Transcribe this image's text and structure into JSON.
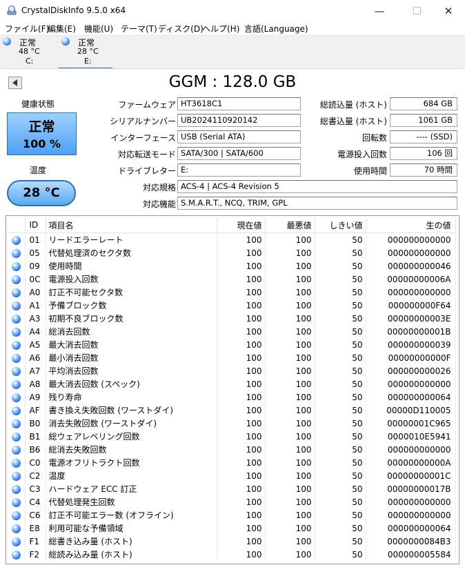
{
  "window": {
    "title": "CrystalDiskInfo 9.5.0 x64",
    "minimize_icon": "minimize-icon",
    "maximize_icon": "maximize-icon",
    "close_icon": "close-icon"
  },
  "menu": [
    "ファイル(F)",
    "編集(E)",
    "機能(U)",
    "テーマ(T)",
    "ディスク(D)",
    "ヘルプ(H)",
    "言語(Language)"
  ],
  "disks": [
    {
      "status": "正常",
      "temp": "48 °C",
      "drive": "C:"
    },
    {
      "status": "正常",
      "temp": "28 °C",
      "drive": "E:"
    }
  ],
  "model": "GGM : 128.0 GB",
  "health": {
    "label": "健康状態",
    "status": "正常",
    "percent": "100 %"
  },
  "temperature": {
    "label": "温度",
    "value": "28 °C"
  },
  "info": {
    "firmware_label": "ファームウェア",
    "firmware": "HT3618C1",
    "serial_label": "シリアルナンバー",
    "serial": "UB2024110920142",
    "interface_label": "インターフェース",
    "interface": "USB (Serial ATA)",
    "transfer_label": "対応転送モード",
    "transfer": "SATA/300 | SATA/600",
    "letter_label": "ドライブレター",
    "letter": "E:",
    "standard_label": "対応規格",
    "standard": "ACS-4 | ACS-4 Revision 5",
    "features_label": "対応機能",
    "features": "S.M.A.R.T., NCQ, TRIM, GPL",
    "host_reads_label": "総読込量 (ホスト)",
    "host_reads": "684 GB",
    "host_writes_label": "総書込量 (ホスト)",
    "host_writes": "1061 GB",
    "rotation_label": "回転数",
    "rotation": "---- (SSD)",
    "power_count_label": "電源投入回数",
    "power_count": "106 回",
    "power_hours_label": "使用時間",
    "power_hours": "70 時間"
  },
  "smart": {
    "headers": {
      "id": "ID",
      "name": "項目名",
      "current": "現在値",
      "worst": "最悪値",
      "threshold": "しきい値",
      "raw": "生の値"
    },
    "rows": [
      {
        "id": "01",
        "name": "リードエラーレート",
        "current": "100",
        "worst": "100",
        "threshold": "50",
        "raw": "000000000000"
      },
      {
        "id": "05",
        "name": "代替処理済のセクタ数",
        "current": "100",
        "worst": "100",
        "threshold": "50",
        "raw": "000000000000"
      },
      {
        "id": "09",
        "name": "使用時間",
        "current": "100",
        "worst": "100",
        "threshold": "50",
        "raw": "000000000046"
      },
      {
        "id": "0C",
        "name": "電源投入回数",
        "current": "100",
        "worst": "100",
        "threshold": "50",
        "raw": "00000000006A"
      },
      {
        "id": "A0",
        "name": "訂正不可能セクタ数",
        "current": "100",
        "worst": "100",
        "threshold": "50",
        "raw": "000000000000"
      },
      {
        "id": "A1",
        "name": "予備ブロック数",
        "current": "100",
        "worst": "100",
        "threshold": "50",
        "raw": "000000000F64"
      },
      {
        "id": "A3",
        "name": "初期不良ブロック数",
        "current": "100",
        "worst": "100",
        "threshold": "50",
        "raw": "00000000003E"
      },
      {
        "id": "A4",
        "name": "総消去回数",
        "current": "100",
        "worst": "100",
        "threshold": "50",
        "raw": "00000000001B"
      },
      {
        "id": "A5",
        "name": "最大消去回数",
        "current": "100",
        "worst": "100",
        "threshold": "50",
        "raw": "000000000039"
      },
      {
        "id": "A6",
        "name": "最小消去回数",
        "current": "100",
        "worst": "100",
        "threshold": "50",
        "raw": "00000000000F"
      },
      {
        "id": "A7",
        "name": "平均消去回数",
        "current": "100",
        "worst": "100",
        "threshold": "50",
        "raw": "000000000026"
      },
      {
        "id": "A8",
        "name": "最大消去回数 (スペック)",
        "current": "100",
        "worst": "100",
        "threshold": "50",
        "raw": "000000000000"
      },
      {
        "id": "A9",
        "name": "残り寿命",
        "current": "100",
        "worst": "100",
        "threshold": "50",
        "raw": "000000000064"
      },
      {
        "id": "AF",
        "name": "書き換え失敗回数 (ワーストダイ)",
        "current": "100",
        "worst": "100",
        "threshold": "50",
        "raw": "00000D110005"
      },
      {
        "id": "B0",
        "name": "消去失敗回数 (ワーストダイ)",
        "current": "100",
        "worst": "100",
        "threshold": "50",
        "raw": "00000001C965"
      },
      {
        "id": "B1",
        "name": "総ウェアレベリング回数",
        "current": "100",
        "worst": "100",
        "threshold": "50",
        "raw": "0000010E5941"
      },
      {
        "id": "B6",
        "name": "総消去失敗回数",
        "current": "100",
        "worst": "100",
        "threshold": "50",
        "raw": "000000000000"
      },
      {
        "id": "C0",
        "name": "電源オフリトラクト回数",
        "current": "100",
        "worst": "100",
        "threshold": "50",
        "raw": "00000000000A"
      },
      {
        "id": "C2",
        "name": "温度",
        "current": "100",
        "worst": "100",
        "threshold": "50",
        "raw": "00000000001C"
      },
      {
        "id": "C3",
        "name": "ハードウェア ECC 訂正",
        "current": "100",
        "worst": "100",
        "threshold": "50",
        "raw": "00000000017B"
      },
      {
        "id": "C4",
        "name": "代替処理発生回数",
        "current": "100",
        "worst": "100",
        "threshold": "50",
        "raw": "000000000000"
      },
      {
        "id": "C6",
        "name": "訂正不可能エラー数 (オフライン)",
        "current": "100",
        "worst": "100",
        "threshold": "50",
        "raw": "000000000000"
      },
      {
        "id": "E8",
        "name": "利用可能な予備領域",
        "current": "100",
        "worst": "100",
        "threshold": "50",
        "raw": "000000000064"
      },
      {
        "id": "F1",
        "name": "総書き込み量 (ホスト)",
        "current": "100",
        "worst": "100",
        "threshold": "50",
        "raw": "0000000084B3"
      },
      {
        "id": "F2",
        "name": "総読み込み量 (ホスト)",
        "current": "100",
        "worst": "100",
        "threshold": "50",
        "raw": "000000005584"
      }
    ]
  }
}
